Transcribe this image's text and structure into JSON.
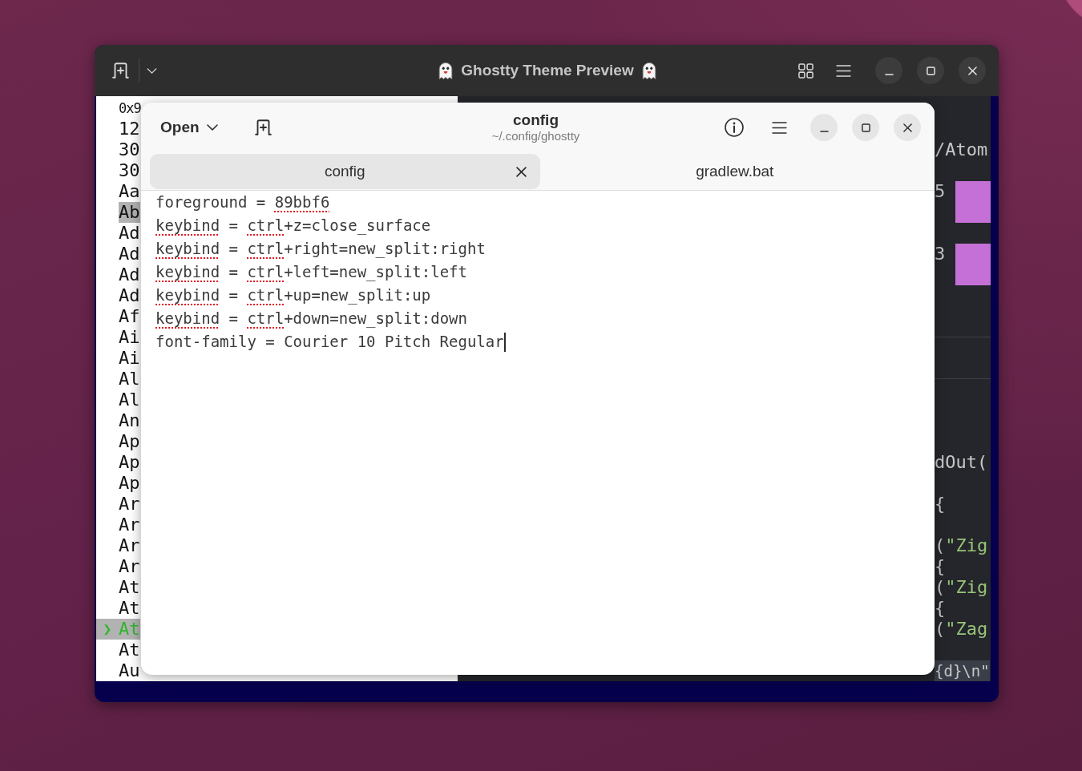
{
  "ghostty_window": {
    "title": "Ghostty Theme Preview"
  },
  "theme_list": {
    "marker": "❯",
    "items": [
      {
        "text": "0x9",
        "selected": false,
        "highlighted": false
      },
      {
        "text": "12",
        "selected": false,
        "highlighted": false
      },
      {
        "text": "30",
        "selected": false,
        "highlighted": false
      },
      {
        "text": "30",
        "selected": false,
        "highlighted": false
      },
      {
        "text": "Aa",
        "selected": false,
        "highlighted": false
      },
      {
        "text": "Ab",
        "selected": false,
        "highlighted": true
      },
      {
        "text": "Ad",
        "selected": false,
        "highlighted": false
      },
      {
        "text": "Ad",
        "selected": false,
        "highlighted": false
      },
      {
        "text": "Ad",
        "selected": false,
        "highlighted": false
      },
      {
        "text": "Ad",
        "selected": false,
        "highlighted": false
      },
      {
        "text": "Af",
        "selected": false,
        "highlighted": false
      },
      {
        "text": "Ai",
        "selected": false,
        "highlighted": false
      },
      {
        "text": "Ai",
        "selected": false,
        "highlighted": false
      },
      {
        "text": "Al",
        "selected": false,
        "highlighted": false
      },
      {
        "text": "Al",
        "selected": false,
        "highlighted": false
      },
      {
        "text": "An",
        "selected": false,
        "highlighted": false
      },
      {
        "text": "Ap",
        "selected": false,
        "highlighted": false
      },
      {
        "text": "Ap",
        "selected": false,
        "highlighted": false
      },
      {
        "text": "Ap",
        "selected": false,
        "highlighted": false
      },
      {
        "text": "Ar",
        "selected": false,
        "highlighted": false
      },
      {
        "text": "Ar",
        "selected": false,
        "highlighted": false
      },
      {
        "text": "Ar",
        "selected": false,
        "highlighted": false
      },
      {
        "text": "Ar",
        "selected": false,
        "highlighted": false
      },
      {
        "text": "At",
        "selected": false,
        "highlighted": false
      },
      {
        "text": "At",
        "selected": false,
        "highlighted": false
      },
      {
        "text": "At",
        "selected": true,
        "highlighted": false
      },
      {
        "text": "At",
        "selected": false,
        "highlighted": false
      },
      {
        "text": "Au",
        "selected": false,
        "highlighted": false
      }
    ]
  },
  "preview": {
    "path": "/Atom",
    "swatches": [
      {
        "label": "5",
        "color": "#c470d6"
      },
      {
        "label": "3",
        "color": "#c470d6"
      }
    ],
    "code_blocks": [
      {
        "lines": [
          {
            "highlighted": false,
            "segments": [
              {
                "kind": "plain",
                "text": "dOut("
              }
            ]
          }
        ]
      },
      {
        "lines": [
          {
            "highlighted": false,
            "segments": [
              {
                "kind": "plain",
                "text": "{"
              }
            ]
          }
        ]
      },
      {
        "lines": [
          {
            "highlighted": false,
            "segments": [
              {
                "kind": "plain",
                "text": "("
              },
              {
                "kind": "string",
                "text": "\"Zig"
              }
            ]
          },
          {
            "highlighted": false,
            "segments": [
              {
                "kind": "plain",
                "text": "{"
              }
            ]
          },
          {
            "highlighted": false,
            "segments": [
              {
                "kind": "plain",
                "text": "("
              },
              {
                "kind": "string",
                "text": "\"Zig"
              }
            ]
          },
          {
            "highlighted": false,
            "segments": [
              {
                "kind": "plain",
                "text": "{"
              }
            ]
          },
          {
            "highlighted": false,
            "segments": [
              {
                "kind": "plain",
                "text": "("
              },
              {
                "kind": "string",
                "text": "\"Zag"
              }
            ]
          }
        ]
      },
      {
        "lines": [
          {
            "highlighted": true,
            "segments": [
              {
                "kind": "plain",
                "text": "{d}\\n\""
              }
            ]
          }
        ]
      }
    ]
  },
  "editor": {
    "open_button": "Open",
    "title": "config",
    "subtitle": "~/.config/ghostty",
    "tabs": [
      {
        "label": "config",
        "selected": true
      },
      {
        "label": "gradlew.bat",
        "selected": false
      }
    ],
    "lines": [
      {
        "cursor": false,
        "segments": [
          {
            "text": "foreground = ",
            "misspelled": false
          },
          {
            "text": "89bbf6",
            "misspelled": true
          }
        ]
      },
      {
        "cursor": false,
        "segments": [
          {
            "text": "keybind",
            "misspelled": true
          },
          {
            "text": " = ",
            "misspelled": false
          },
          {
            "text": "ctrl",
            "misspelled": true
          },
          {
            "text": "+z=close_surface",
            "misspelled": false
          }
        ]
      },
      {
        "cursor": false,
        "segments": [
          {
            "text": "keybind",
            "misspelled": true
          },
          {
            "text": " = ",
            "misspelled": false
          },
          {
            "text": "ctrl",
            "misspelled": true
          },
          {
            "text": "+right=new_split:right",
            "misspelled": false
          }
        ]
      },
      {
        "cursor": false,
        "segments": [
          {
            "text": "keybind",
            "misspelled": true
          },
          {
            "text": " = ",
            "misspelled": false
          },
          {
            "text": "ctrl",
            "misspelled": true
          },
          {
            "text": "+left=new_split:left",
            "misspelled": false
          }
        ]
      },
      {
        "cursor": false,
        "segments": [
          {
            "text": "keybind",
            "misspelled": true
          },
          {
            "text": " = ",
            "misspelled": false
          },
          {
            "text": "ctrl",
            "misspelled": true
          },
          {
            "text": "+up=new_split:up",
            "misspelled": false
          }
        ]
      },
      {
        "cursor": false,
        "segments": [
          {
            "text": "keybind",
            "misspelled": true
          },
          {
            "text": " = ",
            "misspelled": false
          },
          {
            "text": "ctrl",
            "misspelled": true
          },
          {
            "text": "+down=new_split:down",
            "misspelled": false
          }
        ]
      },
      {
        "cursor": true,
        "segments": [
          {
            "text": "font-family = Courier 10 Pitch Regular",
            "misspelled": false
          }
        ]
      }
    ]
  }
}
